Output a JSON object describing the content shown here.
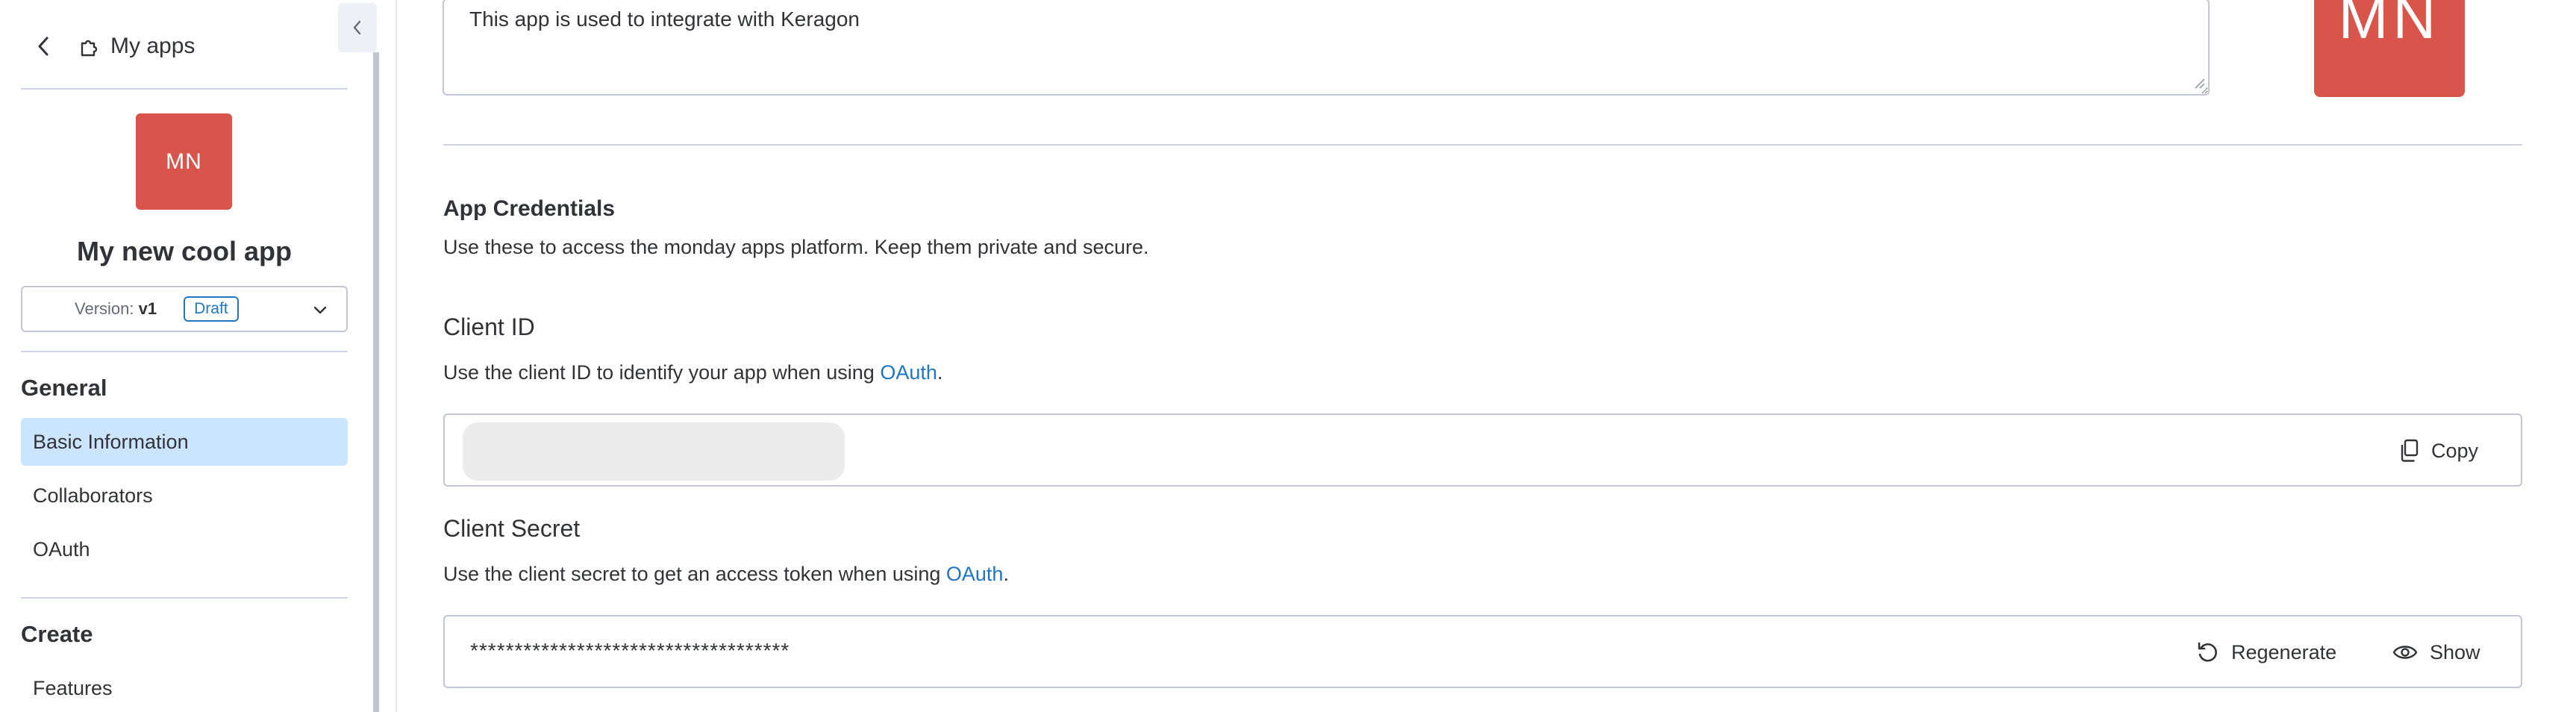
{
  "sidebar": {
    "back_label": "",
    "myapps_label": "My apps",
    "app_initials": "MN",
    "app_name": "My new cool app",
    "version_label": "Version:",
    "version_value": "v1",
    "version_status": "Draft",
    "sections": [
      {
        "title": "General",
        "items": [
          "Basic Information",
          "Collaborators",
          "OAuth"
        ]
      },
      {
        "title": "Create",
        "items": [
          "Features"
        ]
      }
    ],
    "active_item": "Basic Information"
  },
  "main": {
    "description_value": "This app is used to integrate with Keragon",
    "avatar_initials": "MN",
    "credentials": {
      "title": "App Credentials",
      "subtitle": "Use these to access the monday apps platform. Keep them private and secure."
    },
    "client_id": {
      "title": "Client ID",
      "desc_before": "Use the client ID to identify your app when using ",
      "desc_link": "OAuth",
      "desc_after": ".",
      "copy_label": "Copy"
    },
    "client_secret": {
      "title": "Client Secret",
      "desc_before": "Use the client secret to get an access token when using ",
      "desc_link": "OAuth",
      "desc_after": ".",
      "masked_value": "************************************",
      "regenerate_label": "Regenerate",
      "show_label": "Show"
    }
  },
  "colors": {
    "accent": "#1f76c2",
    "avatar": "#d9544a",
    "active_nav": "#cce5ff"
  }
}
